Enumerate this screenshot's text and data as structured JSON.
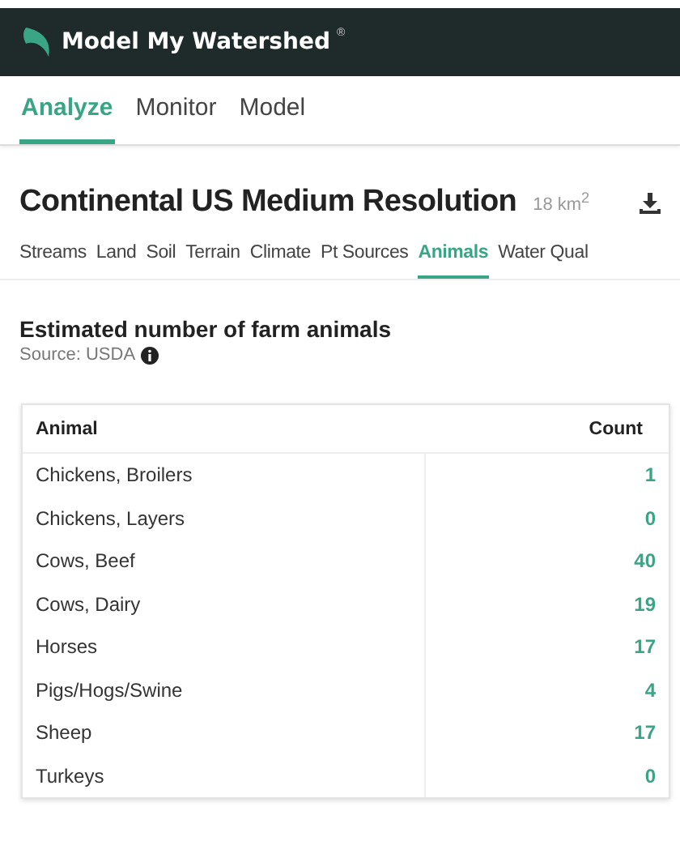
{
  "header": {
    "title": "Model My Watershed",
    "mark": "®"
  },
  "tabs": [
    {
      "label": "Analyze",
      "selected": true
    },
    {
      "label": "Monitor",
      "selected": false
    },
    {
      "label": "Model",
      "selected": false
    }
  ],
  "area": {
    "title": "Continental US Medium Resolution",
    "size": "18 km$^{2}$"
  },
  "subtabs": [
    {
      "label": "Streams",
      "selected": false
    },
    {
      "label": "Land",
      "selected": false
    },
    {
      "label": "Soil",
      "selected": false
    },
    {
      "label": "Terrain",
      "selected": false
    },
    {
      "label": "Climate",
      "selected": false
    },
    {
      "label": "Pt Sources",
      "selected": false
    },
    {
      "label": "Animals",
      "selected": true
    },
    {
      "label": "Water Qual",
      "selected": false
    }
  ],
  "section": {
    "title": "Estimated number of farm animals",
    "source": "Source: USDA"
  },
  "table": {
    "columns": [
      "Animal",
      "Count"
    ],
    "rows": [
      {
        "animal": "Chickens, Broilers",
        "count": "1"
      },
      {
        "animal": "Chickens, Layers",
        "count": "0"
      },
      {
        "animal": "Cows, Beef",
        "count": "40"
      },
      {
        "animal": "Cows, Dairy",
        "count": "19"
      },
      {
        "animal": "Horses",
        "count": "17"
      },
      {
        "animal": "Pigs/Hogs/Swine",
        "count": "4"
      },
      {
        "animal": "Sheep",
        "count": "17"
      },
      {
        "animal": "Turkeys",
        "count": "0"
      }
    ]
  }
}
